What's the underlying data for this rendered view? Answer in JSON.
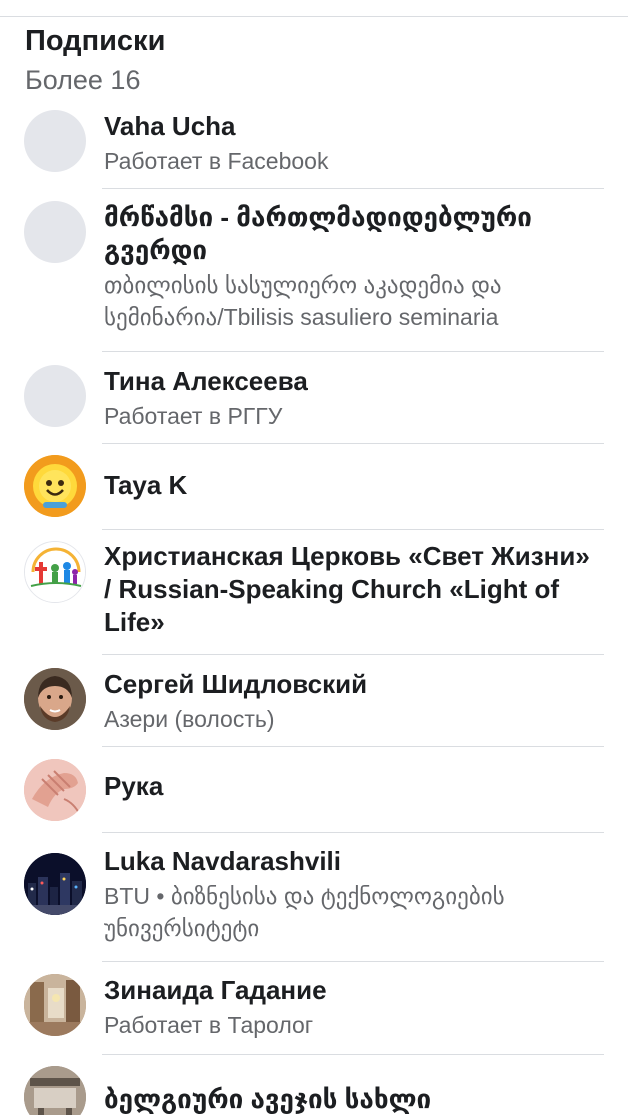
{
  "section": {
    "title": "Подписки",
    "count": "Более 16"
  },
  "items": [
    {
      "name": "Vaha Ucha",
      "sub": "Работает в Facebook",
      "avatar": "placeholder-avatar"
    },
    {
      "name": "მრწამსი - მართლმადიდებლური გვერდი",
      "sub": "თბილისის სასულიერო აკადემია და სემინარია/Tbilisis sasuliero seminaria",
      "avatar": "placeholder-avatar"
    },
    {
      "name": "Тина Алексеева",
      "sub": "Работает в РГГУ",
      "avatar": "placeholder-avatar"
    },
    {
      "name": "Taya K",
      "sub": "",
      "avatar": "smiley-sun-avatar"
    },
    {
      "name": "Христианская Церковь «Свет Жизни» / Russian-Speaking Church «Light of Life»",
      "sub": "",
      "avatar": "church-logo-avatar"
    },
    {
      "name": "Сергей Шидловский",
      "sub": "Азери (волость)",
      "avatar": "man-photo-avatar"
    },
    {
      "name": "Рука",
      "sub": "",
      "avatar": "hand-photo-avatar"
    },
    {
      "name": "Luka Navdarashvili",
      "sub": "BTU • ბიზნესისა და ტექნოლოგიების უნივერსიტეტი",
      "avatar": "night-city-avatar"
    },
    {
      "name": "Зинаида Гадание",
      "sub": "Работает в Таролог",
      "avatar": "room-photo-avatar"
    },
    {
      "name": "ბელგიური ავეჯის სახლი",
      "sub": "",
      "avatar": "furniture-photo-avatar"
    }
  ]
}
